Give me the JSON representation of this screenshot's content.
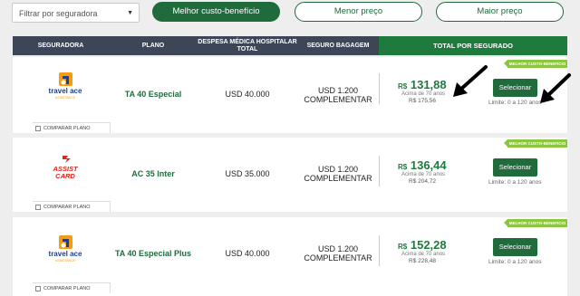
{
  "filters": {
    "select_placeholder": "Filtrar por seguradora",
    "tabs": [
      {
        "label": "Melhor custo-benefício",
        "active": true
      },
      {
        "label": "Menor preço",
        "active": false
      },
      {
        "label": "Maior preço",
        "active": false
      }
    ]
  },
  "table": {
    "headers": {
      "seguradora": "SEGURADORA",
      "plano": "PLANO",
      "despesa": "DESPESA MÉDICA HOSPITALAR TOTAL",
      "bagagem": "SEGURO BAGAGEM",
      "total": "TOTAL POR SEGURADO"
    },
    "rows": [
      {
        "insurer": "travel ace",
        "insurer_sub": "ASSISTANCE",
        "plan": "TA 40 Especial",
        "despesa": "USD 40.000",
        "bagagem_line1": "USD 1.200",
        "bagagem_line2": "COMPLEMENTAR",
        "currency": "R$",
        "price": "131,88",
        "age_note": "Acima de 70 anos",
        "price_over70": "R$ 175,56",
        "button": "Selecionar",
        "limit": "Limite: 0 a 120 anos",
        "ribbon": "MELHOR CUSTO-BENEFÍCIO",
        "compare": "COMPARAR PLANO"
      },
      {
        "insurer": "ASSIST CARD",
        "plan": "AC 35 Inter",
        "despesa": "USD 35.000",
        "bagagem_line1": "USD 1.200",
        "bagagem_line2": "COMPLEMENTAR",
        "currency": "R$",
        "price": "136,44",
        "age_note": "Acima de 70 anos",
        "price_over70": "R$ 204,72",
        "button": "Selecionar",
        "limit": "Limite: 0 a 120 anos",
        "ribbon": "MELHOR CUSTO-BENEFÍCIO",
        "compare": "COMPARAR PLANO"
      },
      {
        "insurer": "travel ace",
        "insurer_sub": "ASSISTANCE",
        "plan": "TA 40 Especial Plus",
        "despesa": "USD 40.000",
        "bagagem_line1": "USD 1.200",
        "bagagem_line2": "COMPLEMENTAR",
        "currency": "R$",
        "price": "152,28",
        "age_note": "Acima de 70 anos",
        "price_over70": "R$ 228,48",
        "button": "Selecionar",
        "limit": "Limite: 0 a 120 anos",
        "ribbon": "MELHOR CUSTO-BENEFÍCIO",
        "compare": "COMPARAR PLANO"
      }
    ]
  },
  "colors": {
    "primary_green": "#1f6b3c",
    "header_dark": "#3c4656",
    "ribbon_green": "#8cc641",
    "travelace_orange": "#f39c12",
    "travelace_blue": "#1c3f94",
    "assistcard_red": "#e2231a"
  }
}
